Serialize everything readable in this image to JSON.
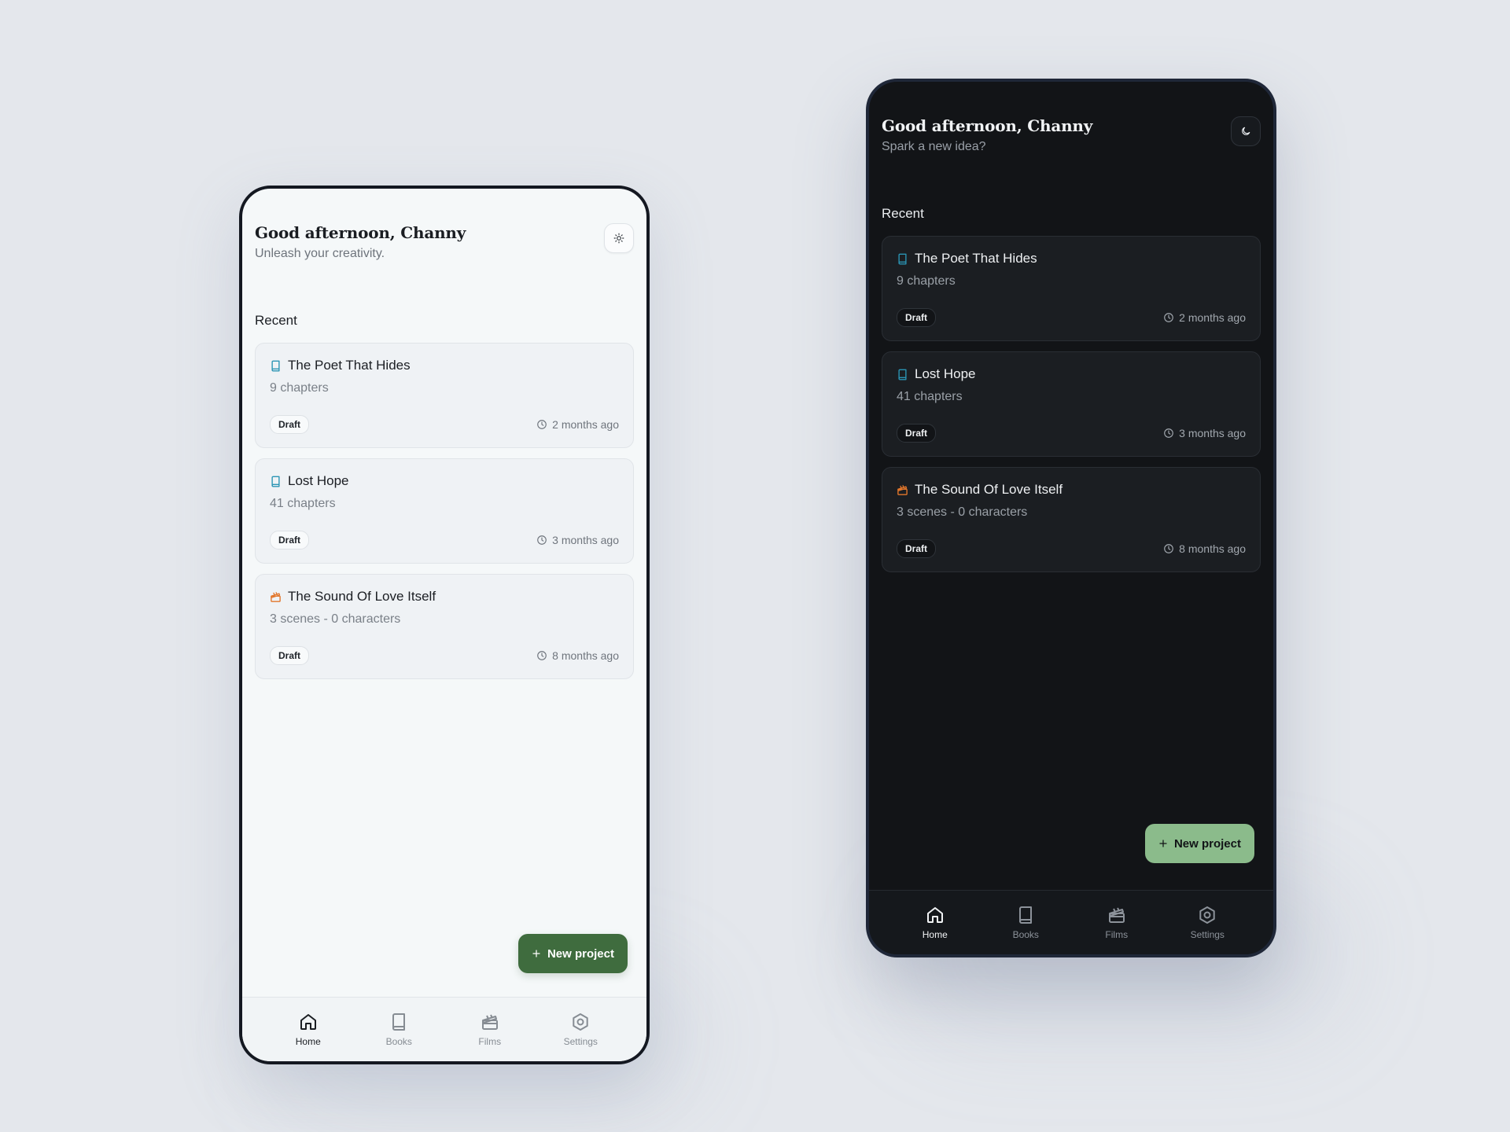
{
  "colors": {
    "background": "#e4e7ec",
    "light_surface": "#f5f8f9",
    "dark_surface": "#121417",
    "light_fab": "#3f6c3e",
    "dark_fab": "#8bbb8b",
    "book_icon": "#2a94b4",
    "film_icon": "#e2762b"
  },
  "light": {
    "greeting": "Good afternoon, Channy",
    "subtitle": "Unleash your creativity.",
    "theme_icon": "sun-icon",
    "section_label": "Recent",
    "projects": [
      {
        "icon": "book-icon",
        "title": "The Poet That Hides",
        "meta": "9 chapters",
        "status": "Draft",
        "time": "2 months ago"
      },
      {
        "icon": "book-icon",
        "title": "Lost Hope",
        "meta": "41 chapters",
        "status": "Draft",
        "time": "3 months ago"
      },
      {
        "icon": "film-icon",
        "title": "The Sound Of Love Itself",
        "meta": "3 scenes - 0 characters",
        "status": "Draft",
        "time": "8 months ago"
      }
    ],
    "fab_label": "New project",
    "tabs": [
      {
        "label": "Home",
        "icon": "home-icon",
        "active": true
      },
      {
        "label": "Books",
        "icon": "book-icon",
        "active": false
      },
      {
        "label": "Films",
        "icon": "clapperboard-icon",
        "active": false
      },
      {
        "label": "Settings",
        "icon": "settings-icon",
        "active": false
      }
    ]
  },
  "dark": {
    "greeting": "Good afternoon, Channy",
    "subtitle": "Spark a new idea?",
    "theme_icon": "moon-icon",
    "section_label": "Recent",
    "projects": [
      {
        "icon": "book-icon",
        "title": "The Poet That Hides",
        "meta": "9 chapters",
        "status": "Draft",
        "time": "2 months ago"
      },
      {
        "icon": "book-icon",
        "title": "Lost Hope",
        "meta": "41 chapters",
        "status": "Draft",
        "time": "3 months ago"
      },
      {
        "icon": "film-icon",
        "title": "The Sound Of Love Itself",
        "meta": "3 scenes - 0 characters",
        "status": "Draft",
        "time": "8 months ago"
      }
    ],
    "fab_label": "New project",
    "tabs": [
      {
        "label": "Home",
        "icon": "home-icon",
        "active": true
      },
      {
        "label": "Books",
        "icon": "book-icon",
        "active": false
      },
      {
        "label": "Films",
        "icon": "clapperboard-icon",
        "active": false
      },
      {
        "label": "Settings",
        "icon": "settings-icon",
        "active": false
      }
    ]
  }
}
